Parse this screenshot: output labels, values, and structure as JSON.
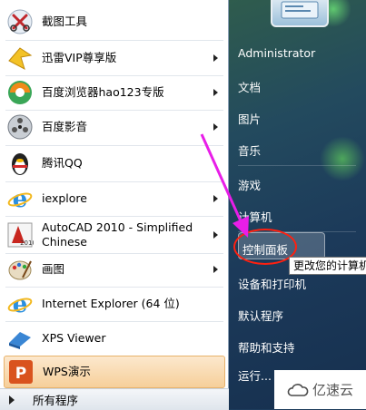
{
  "programs": [
    {
      "label": "截图工具",
      "icon": "scissors-icon",
      "has_submenu": false
    },
    {
      "label": "迅雷VIP尊享版",
      "icon": "thunder-bird-icon",
      "has_submenu": true
    },
    {
      "label": "百度浏览器hao123专版",
      "icon": "baidu-browser-icon",
      "has_submenu": true
    },
    {
      "label": "百度影音",
      "icon": "baidu-player-icon",
      "has_submenu": true
    },
    {
      "label": "腾讯QQ",
      "icon": "qq-penguin-icon",
      "has_submenu": false
    },
    {
      "label": "iexplore",
      "icon": "ie-icon",
      "has_submenu": true
    },
    {
      "label": "AutoCAD 2010 - Simplified Chinese",
      "icon": "autocad-icon",
      "has_submenu": true
    },
    {
      "label": "画图",
      "icon": "paint-palette-icon",
      "has_submenu": true
    },
    {
      "label": "Internet Explorer (64 位)",
      "icon": "ie-icon",
      "has_submenu": false
    },
    {
      "label": "XPS Viewer",
      "icon": "xps-viewer-icon",
      "has_submenu": false
    },
    {
      "label": "WPS演示",
      "icon": "wps-presentation-icon",
      "has_submenu": false
    }
  ],
  "all_programs_label": "所有程序",
  "right_menu": {
    "user": "Administrator",
    "documents": "文档",
    "pictures": "图片",
    "music": "音乐",
    "games": "游戏",
    "computer": "计算机",
    "control_panel": "控制面板",
    "devices_printers": "设备和打印机",
    "default_programs": "默认程序",
    "help_support": "帮助和支持",
    "run": "运行..."
  },
  "tooltip": "更改您的计算机",
  "watermark": "亿速云",
  "colors": {
    "highlight_annotation": "#ff2010",
    "arrow": "#e81ee8"
  }
}
